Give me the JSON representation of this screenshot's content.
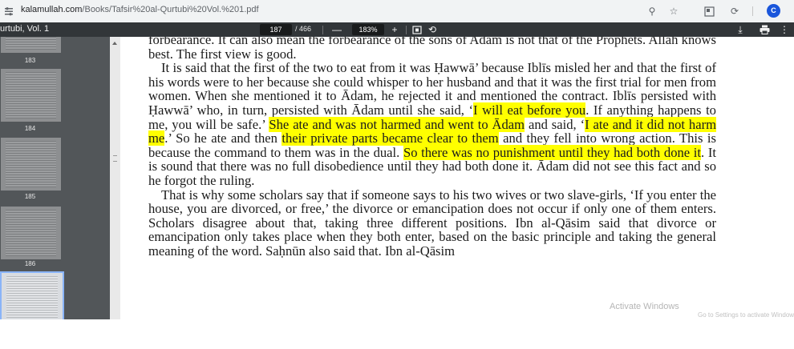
{
  "browser": {
    "url_host": "kalamullah.com",
    "url_path": "/Books/Tafsir%20al-Qurtubi%20Vol.%201.pdf",
    "profile_initial": "C"
  },
  "pdf_toolbar": {
    "doc_title": "urtubi, Vol. 1",
    "current_page": "187",
    "total_pages": "/ 466",
    "zoom": "183%"
  },
  "thumbnails": [
    {
      "label": "183"
    },
    {
      "label": "184"
    },
    {
      "label": "185"
    },
    {
      "label": "186"
    }
  ],
  "page": {
    "p1": "forbearance. It can also mean the forbearance of the sons of Adam is not that of the Prophets. Allah knows best. The first view is good.",
    "p2_a": "It is said that the first of the two to eat from it was Ḥawwā’ because Iblīs misled her and that the first of his words were to her because she could whisper to her husband and that it was the first trial for men from women. When she mentioned it to Ādam, he rejected it and mentioned the contract. Iblīs persisted with Ḥawwā’ who, in turn, persisted with Ādam until she said, ‘",
    "p2_h1": "I will eat before you",
    "p2_b": ". If anything happens to me, you will be safe.’ ",
    "p2_h2": "She ate and was not harmed and went to Ādam",
    "p2_c": " and said, ‘",
    "p2_h3": "I ate and it did not harm me",
    "p2_d": ".’ So he ate and then ",
    "p2_h4": "their private parts became clear to them",
    "p2_e": " and they fell into wrong action. This is because the command to them was in the dual. ",
    "p2_h5": "So there was no punishment until they had both done it",
    "p2_f": ". It is sound that there was no full disobedience until they had both done it. Ādam did not see this fact and so he forgot the ruling.",
    "p3": "That is why some scholars say that if someone says to his two wives or two slave-girls, ‘If you enter the house, you are divorced, or free,’ the divorce or emancipation does not occur if only one of them enters. Scholars disagree about that, taking three different positions. Ibn al-Qāsim said that divorce or emancipation only takes place when they both enter, based on the basic principle and taking the general meaning of the word. Saḥnūn also said that. Ibn al-Qāsim"
  },
  "watermark": {
    "line1": "Activate Windows",
    "line2": "Go to Settings to activate Windows."
  },
  "colors": {
    "highlight": "#ffff00",
    "toolbar": "#323639",
    "sidebar": "#525659"
  }
}
